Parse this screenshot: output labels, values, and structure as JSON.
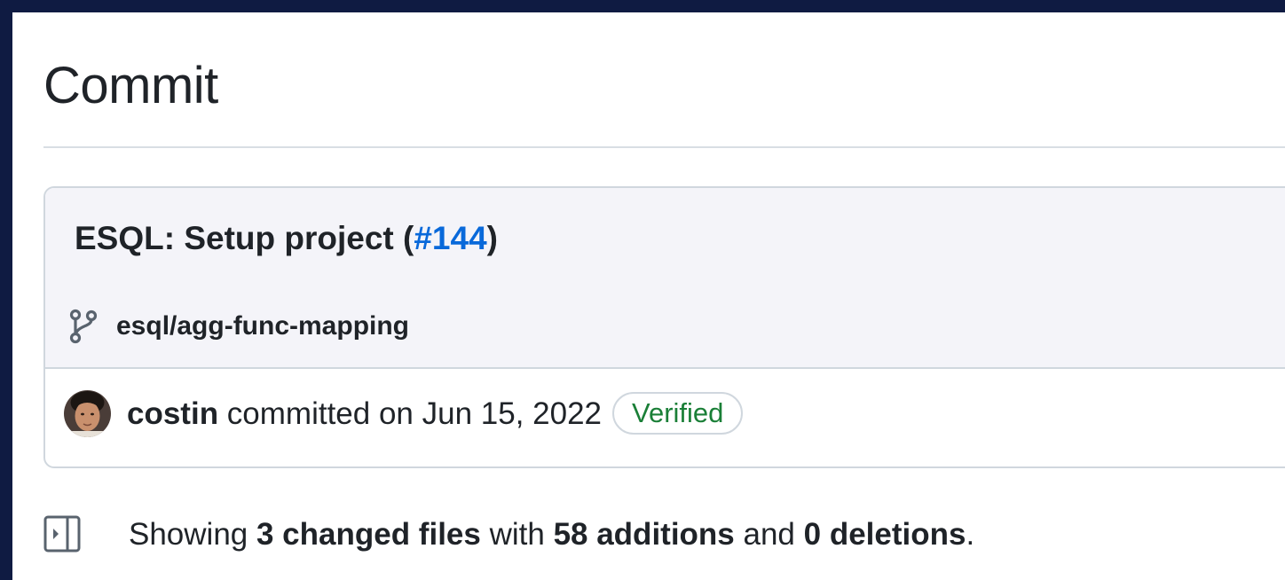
{
  "page": {
    "title": "Commit"
  },
  "commit": {
    "message_prefix": "ESQL: Setup project (",
    "pr_number": "#144",
    "message_suffix": ")",
    "branch": "esql/agg-func-mapping",
    "author": "costin",
    "committed_text": " committed on Jun 15, 2022",
    "verified_label": "Verified"
  },
  "summary": {
    "prefix": "Showing ",
    "files": "3 changed files",
    "middle1": " with ",
    "additions": "58 additions",
    "middle2": " and ",
    "deletions": "0 deletions",
    "suffix": "."
  },
  "icons": {
    "branch": "git-branch-icon",
    "split": "sidebar-expand-icon"
  },
  "colors": {
    "frame": "#0f1b42",
    "link": "#0969da",
    "verified": "#1a7f37",
    "header_bg": "#f4f4f9",
    "border": "#d0d7de",
    "text": "#1f2328"
  }
}
